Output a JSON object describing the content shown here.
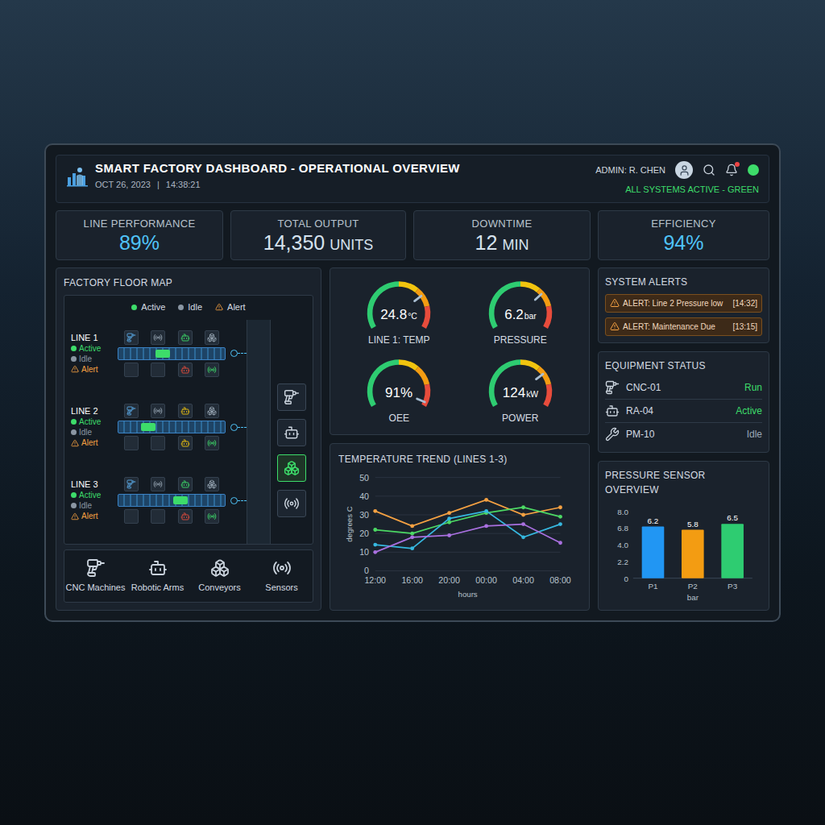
{
  "header": {
    "title": "SMART FACTORY DASHBOARD - OPERATIONAL OVERVIEW",
    "date": "OCT 26, 2023",
    "separator": "|",
    "time": "14:38:21",
    "admin": "ADMIN: R. CHEN",
    "notifications_unread": true,
    "status": "ALL SYSTEMS ACTIVE - GREEN"
  },
  "kpis": [
    {
      "label": "LINE PERFORMANCE",
      "value": "89%",
      "color": "#4fc3f7"
    },
    {
      "label": "TOTAL OUTPUT",
      "value": "14,350",
      "unit": "UNITS",
      "color": "#d6e3ee"
    },
    {
      "label": "DOWNTIME",
      "value": "12",
      "unit": "MIN",
      "color": "#d6e3ee"
    },
    {
      "label": "EFFICIENCY",
      "value": "94%",
      "color": "#4fc3f7"
    }
  ],
  "floor_map": {
    "title": "FACTORY FLOOR MAP",
    "legend": [
      {
        "label": "Active",
        "kind": "active",
        "color": "#3ddc6a"
      },
      {
        "label": "Idle",
        "kind": "idle",
        "color": "#8a96a3"
      },
      {
        "label": "Alert",
        "kind": "alert",
        "color": "#f5a142"
      }
    ],
    "lines": [
      {
        "name": "LINE 1",
        "product_level": 0.42,
        "statuses": [
          {
            "label": "Active",
            "kind": "active",
            "color": "#3ddc6a"
          },
          {
            "label": "Idle",
            "kind": "idle",
            "color": "#8a96a3"
          },
          {
            "label": "Alert",
            "kind": "alert",
            "color": "#f5a142"
          }
        ],
        "top": [
          {
            "kind": "cnc",
            "color": "#5aa9e6"
          },
          {
            "kind": "sensor",
            "color": "#9aa8b6"
          },
          {
            "kind": "robot",
            "color": "#3ddc6a"
          },
          {
            "kind": "conveyor",
            "color": "#9aa8b6"
          }
        ],
        "bottom": [
          {
            "kind": "empty"
          },
          {
            "kind": "empty"
          },
          {
            "kind": "robot",
            "color": "#e74c3c"
          },
          {
            "kind": "sensor",
            "color": "#3ddc6a"
          }
        ]
      },
      {
        "name": "LINE 2",
        "product_level": 0.28,
        "statuses": [
          {
            "label": "Active",
            "kind": "active",
            "color": "#3ddc6a"
          },
          {
            "label": "Idle",
            "kind": "idle",
            "color": "#8a96a3"
          },
          {
            "label": "Alert",
            "kind": "alert",
            "color": "#f5a142"
          }
        ],
        "top": [
          {
            "kind": "cnc",
            "color": "#5aa9e6"
          },
          {
            "kind": "sensor",
            "color": "#9aa8b6"
          },
          {
            "kind": "robot",
            "color": "#f1c40f"
          },
          {
            "kind": "conveyor",
            "color": "#9aa8b6"
          }
        ],
        "bottom": [
          {
            "kind": "empty"
          },
          {
            "kind": "empty"
          },
          {
            "kind": "robot",
            "color": "#f1c40f"
          },
          {
            "kind": "sensor",
            "color": "#3ddc6a"
          }
        ]
      },
      {
        "name": "LINE 3",
        "product_level": 0.58,
        "statuses": [
          {
            "label": "Active",
            "kind": "active",
            "color": "#3ddc6a"
          },
          {
            "label": "Idle",
            "kind": "idle",
            "color": "#8a96a3"
          },
          {
            "label": "Alert",
            "kind": "alert",
            "color": "#f5a142"
          }
        ],
        "top": [
          {
            "kind": "cnc",
            "color": "#5aa9e6"
          },
          {
            "kind": "sensor",
            "color": "#9aa8b6"
          },
          {
            "kind": "robot",
            "color": "#3ddc6a"
          },
          {
            "kind": "conveyor",
            "color": "#9aa8b6"
          }
        ],
        "bottom": [
          {
            "kind": "empty"
          },
          {
            "kind": "empty"
          },
          {
            "kind": "robot",
            "color": "#e74c3c"
          },
          {
            "kind": "sensor",
            "color": "#3ddc6a"
          }
        ]
      }
    ],
    "devices": [
      {
        "kind": "cnc",
        "selected": false
      },
      {
        "kind": "robot",
        "selected": false
      },
      {
        "kind": "conveyor",
        "selected": true
      },
      {
        "kind": "sensor",
        "selected": false
      }
    ],
    "categories": [
      {
        "label": "CNC Machines",
        "kind": "cnc"
      },
      {
        "label": "Robotic Arms",
        "kind": "robot"
      },
      {
        "label": "Conveyors",
        "kind": "conveyor"
      },
      {
        "label": "Sensors",
        "kind": "sensor"
      }
    ]
  },
  "gauges": [
    {
      "label": "LINE 1: TEMP",
      "value": "24.8",
      "unit": "°C",
      "level": 0.72
    },
    {
      "label": "PRESSURE",
      "value": "6.2",
      "unit": "bar",
      "level": 0.7
    },
    {
      "label": "OEE",
      "value": "91%",
      "level": 0.97
    },
    {
      "label": "POWER",
      "value": "124",
      "unit": "kW",
      "level": 0.72
    }
  ],
  "temperature_chart": {
    "title": "TEMPERATURE TREND (LINES 1-3)",
    "y_label": "degrees C",
    "x_label": "hours",
    "y_ticks": [
      "0",
      "10",
      "20",
      "30",
      "40",
      "50"
    ],
    "x_ticks": [
      "12:00",
      "16:00",
      "20:00",
      "00:00",
      "04:00",
      "08:00"
    ],
    "series": [
      {
        "color": "#f5a142",
        "values": [
          32,
          24,
          31,
          38,
          30,
          34
        ]
      },
      {
        "color": "#4cd964",
        "values": [
          22,
          20,
          26,
          31,
          34,
          29
        ]
      },
      {
        "color": "#36b8e0",
        "values": [
          14,
          12,
          28,
          32,
          18,
          25
        ]
      },
      {
        "color": "#a970e0",
        "values": [
          10,
          18,
          19,
          24,
          25,
          15
        ]
      }
    ]
  },
  "alerts": {
    "title": "SYSTEM ALERTS",
    "items": [
      {
        "text": "ALERT: Line 2 Pressure low",
        "time": "[14:32]"
      },
      {
        "text": "ALERT: Maintenance Due",
        "time": "[13:15]"
      }
    ]
  },
  "equipment": {
    "title": "EQUIPMENT STATUS",
    "items": [
      {
        "name": "CNC-01",
        "kind": "cnc",
        "status": "Run",
        "color": "#3ddc6a"
      },
      {
        "name": "RA-04",
        "kind": "robot",
        "status": "Active",
        "color": "#3ddc6a"
      },
      {
        "name": "PM-10",
        "kind": "tool",
        "status": "Idle",
        "color": "#9aa8b6"
      }
    ]
  },
  "pressure_chart": {
    "title": "PRESSURE SENSOR OVERVIEW",
    "x_label": "bar",
    "y_ticks": [
      "8.0",
      "6.8",
      "4.0",
      "2.2",
      "0"
    ],
    "bars": [
      {
        "label": "P1",
        "value": 6.2,
        "reading": "6.2",
        "color": "#2196f3"
      },
      {
        "label": "P2",
        "value": 5.8,
        "reading": "5.8",
        "color": "#f39c12"
      },
      {
        "label": "P3",
        "value": 6.5,
        "reading": "6.5",
        "color": "#2ecc71"
      }
    ]
  }
}
